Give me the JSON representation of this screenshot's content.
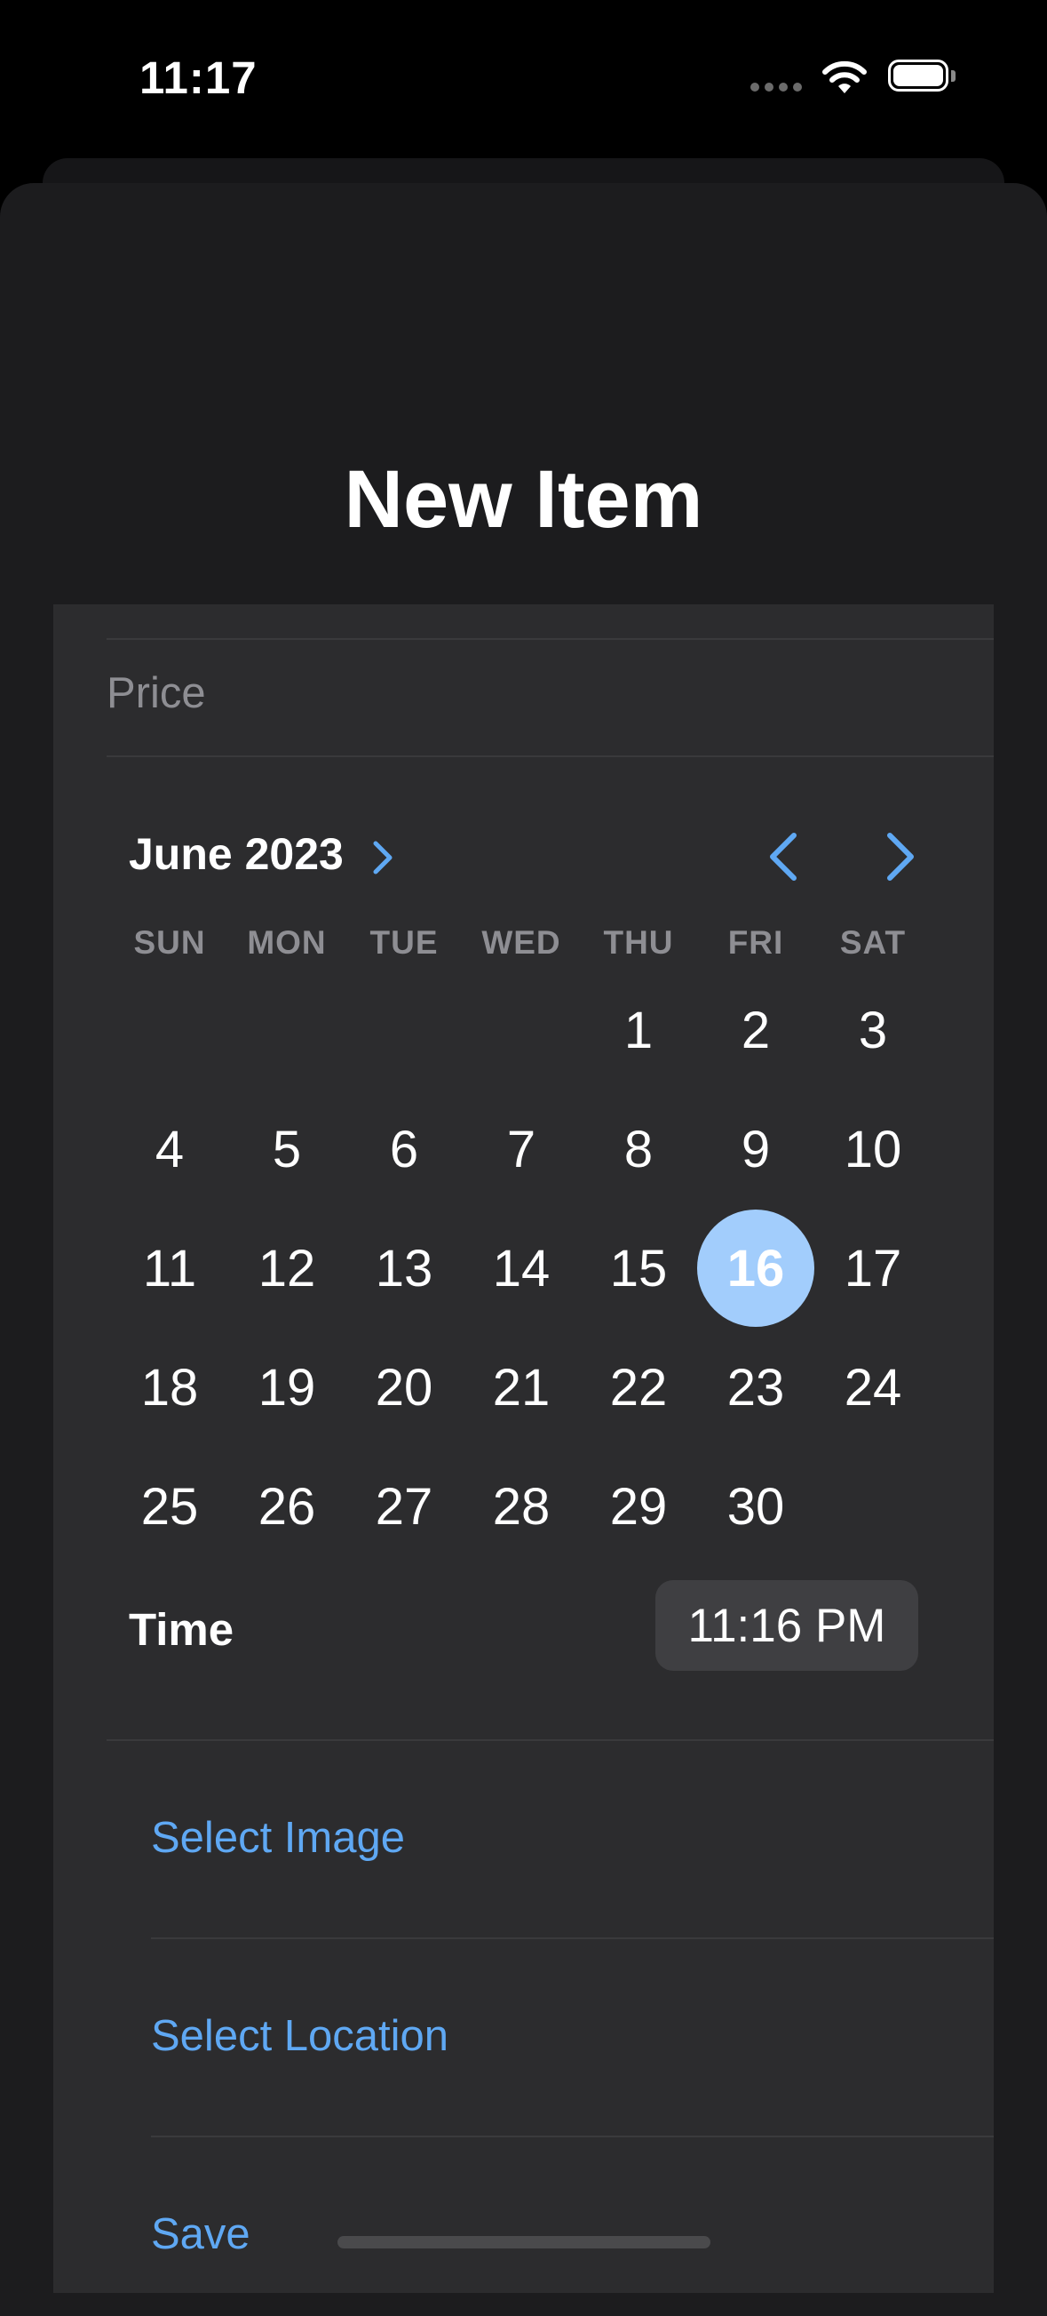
{
  "status_bar": {
    "time": "11:17"
  },
  "nav": {
    "title": "New Item"
  },
  "form": {
    "price_placeholder": "Price"
  },
  "calendar": {
    "month_label": "June 2023",
    "weekdays": [
      "SUN",
      "MON",
      "TUE",
      "WED",
      "THU",
      "FRI",
      "SAT"
    ],
    "weeks": [
      [
        "",
        "",
        "",
        "",
        "1",
        "2",
        "3"
      ],
      [
        "4",
        "5",
        "6",
        "7",
        "8",
        "9",
        "10"
      ],
      [
        "11",
        "12",
        "13",
        "14",
        "15",
        "16",
        "17"
      ],
      [
        "18",
        "19",
        "20",
        "21",
        "22",
        "23",
        "24"
      ],
      [
        "25",
        "26",
        "27",
        "28",
        "29",
        "30",
        ""
      ]
    ],
    "selected_day": "16",
    "accent_color": "#5fa8f3",
    "selected_color": "#a2cdfc"
  },
  "time": {
    "label": "Time",
    "value": "11:16 PM"
  },
  "actions": {
    "select_image": "Select Image",
    "select_location": "Select Location",
    "save": "Save"
  },
  "icons": [
    "wifi-icon",
    "battery-icon",
    "chevron-right-icon",
    "chevron-left-icon"
  ]
}
